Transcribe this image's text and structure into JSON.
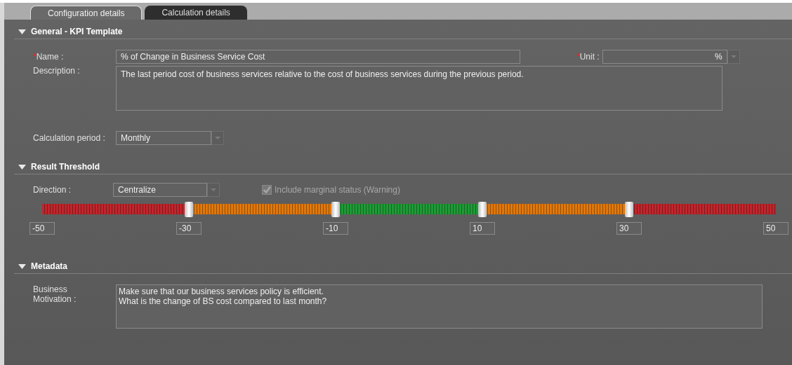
{
  "tabs": [
    {
      "label": "Configuration details",
      "selected": true
    },
    {
      "label": "Calculation details",
      "selected": false
    }
  ],
  "general": {
    "title": "General - KPI Template",
    "expanded": true,
    "name": {
      "required_mark": "*",
      "label": "Name :",
      "value": "% of Change in Business Service Cost"
    },
    "unit": {
      "required_mark": "*",
      "label": "Unit :",
      "value": "%"
    },
    "description": {
      "label": "Description :",
      "value": "The last period cost of business services relative to the cost of business services during the previous period."
    },
    "calculation_period": {
      "label": "Calculation period :",
      "value": "Monthly"
    }
  },
  "result_threshold": {
    "title": "Result Threshold",
    "expanded": true,
    "direction": {
      "label": "Direction :",
      "value": "Centralize"
    },
    "include_marginal": {
      "label": "Include marginal status (Warning)",
      "checked": true,
      "disabled": true
    },
    "segments": [
      {
        "color": "#c0262c"
      },
      {
        "color": "#e0780c"
      },
      {
        "color": "#1f9a36"
      },
      {
        "color": "#e0780c"
      },
      {
        "color": "#c0262c"
      }
    ],
    "thumbs": [
      {
        "level": 0.2
      },
      {
        "level": 0.4
      },
      {
        "level": 0.6
      },
      {
        "level": 0.8
      }
    ],
    "scale_values": [
      "-50",
      "-30",
      "-10",
      "10",
      "30",
      "50"
    ]
  },
  "metadata": {
    "title": "Metadata",
    "expanded": true,
    "business_motivation": {
      "label": "Business Motivation :",
      "lines": [
        "Make sure that our business services policy is efficient.",
        "What is the change of BS cost compared to last month?"
      ]
    }
  }
}
